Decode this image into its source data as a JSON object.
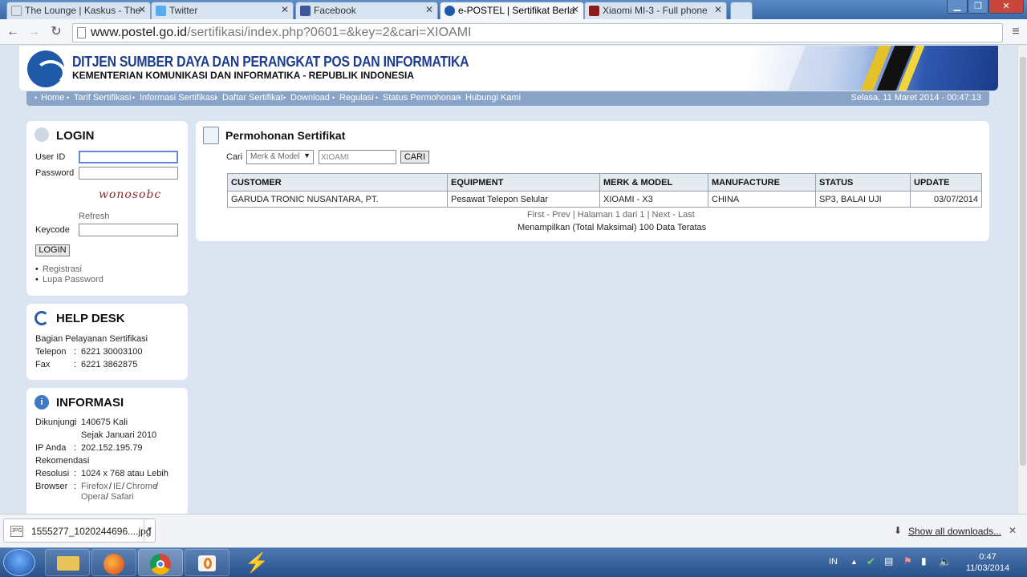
{
  "browser": {
    "tabs": [
      {
        "label": "The Lounge | Kaskus - The",
        "icon": "kaskus-icon",
        "color": "#d9e4f2"
      },
      {
        "label": "Twitter",
        "icon": "twitter-icon",
        "color": "#55acee"
      },
      {
        "label": "Facebook",
        "icon": "facebook-icon",
        "color": "#3b5998"
      },
      {
        "label": "e-POSTEL | Sertifikat Berla",
        "icon": "epostel-icon",
        "color": "#1e5aa8"
      },
      {
        "label": "Xiaomi MI-3 - Full phone",
        "icon": "gsmarena-icon",
        "color": "#8a1c1c"
      }
    ],
    "url_host": "www.postel.go.id",
    "url_path": "/sertifikasi/index.php?0601=&key=2&cari=XIOAMI"
  },
  "header": {
    "title": "DITJEN SUMBER DAYA DAN PERANGKAT POS DAN INFORMATIKA",
    "subtitle": "KEMENTERIAN KOMUNIKASI DAN INFORMATIKA - REPUBLIK INDONESIA"
  },
  "menu": {
    "items": [
      "Home",
      "Tarif Sertifikasi",
      "Informasi Sertifikasi",
      "Daftar Sertifikat",
      "Download",
      "Regulasi",
      "Status Permohonan",
      "Hubungi Kami"
    ],
    "datetime": "Selasa, 11 Maret 2014 - 00:47:13"
  },
  "login": {
    "title": "LOGIN",
    "userid_label": "User ID",
    "password_label": "Password",
    "captcha": "wonosobc",
    "refresh": "Refresh",
    "keycode_label": "Keycode",
    "button": "LOGIN",
    "links": [
      "Registrasi",
      "Lupa Password"
    ]
  },
  "helpdesk": {
    "title": "HELP DESK",
    "line1": "Bagian Pelayanan Sertifikasi",
    "telepon_label": "Telepon",
    "telepon": "6221 30003100",
    "fax_label": "Fax",
    "fax": "6221 3862875",
    "sep": ":"
  },
  "informasi": {
    "title": "INFORMASI",
    "dikunjungi_label": "Dikunjungi",
    "dikunjungi": "140675 Kali",
    "sejak": "Sejak Januari 2010",
    "ip_label": "IP Anda",
    "ip": "202.152.195.79",
    "rekomendasi": "Rekomendasi",
    "resolusi_label": "Resolusi",
    "resolusi": "1024 x 768 atau Lebih",
    "browser_label": "Browser",
    "browsers1": [
      "Firefox",
      "IE",
      "Chrome"
    ],
    "browsers2": [
      "Opera",
      "Safari"
    ],
    "slash": "/"
  },
  "main": {
    "title": "Permohonan Sertifikat",
    "cari_label": "Cari",
    "select_value": "Merk & Model",
    "search_value": "XIOAMI",
    "cari_button": "CARI",
    "columns": [
      "CUSTOMER",
      "EQUIPMENT",
      "MERK & MODEL",
      "MANUFACTURE",
      "STATUS",
      "UPDATE"
    ],
    "rows": [
      [
        "GARUDA TRONIC NUSANTARA, PT.",
        "Pesawat Telepon Selular",
        "XIOAMI - X3",
        "CHINA",
        "SP3, BALAI UJI",
        "03/07/2014"
      ]
    ],
    "pager": {
      "first": "First",
      "prev": "Prev",
      "halaman": "Halaman 1 dari 1",
      "next": "Next",
      "last": "Last",
      "sep1": " - ",
      "sep2": " | "
    },
    "note": "Menampilkan (Total Maksimal) 100 Data Teratas"
  },
  "downloads": {
    "file": "1555277_1020244696....jpg",
    "file_icon": "JPG",
    "show_all": "Show all downloads..."
  },
  "taskbar": {
    "lang": "IN",
    "time": "0:47",
    "date": "11/03/2014"
  }
}
